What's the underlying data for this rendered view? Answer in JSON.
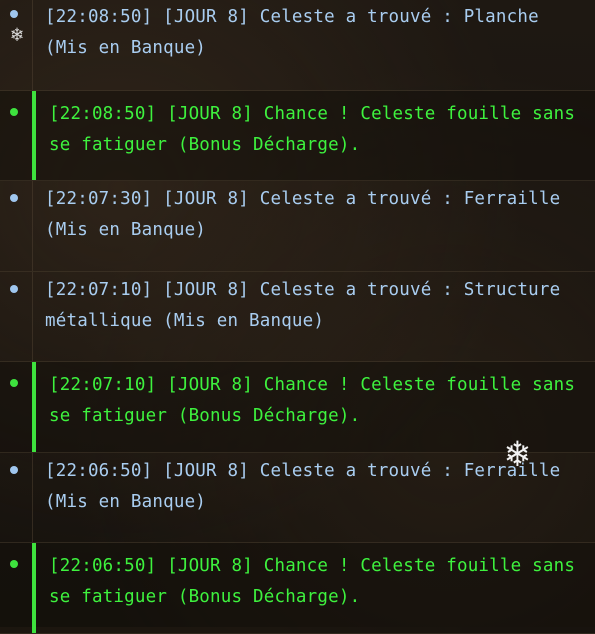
{
  "log": {
    "entries": [
      {
        "type": "info",
        "text": "[22:08:50] [JOUR 8] Celeste a trouvé : Planche\n(Mis en Banque)"
      },
      {
        "type": "success",
        "text": "[22:08:50] [JOUR 8] Chance ! Celeste fouille sans\nse fatiguer (Bonus Décharge)."
      },
      {
        "type": "info",
        "text": "[22:07:30] [JOUR 8] Celeste a trouvé : Ferraille\n(Mis en Banque)"
      },
      {
        "type": "info",
        "text": "[22:07:10] [JOUR 8] Celeste a trouvé : Structure\nmétallique (Mis en Banque)"
      },
      {
        "type": "success",
        "text": "[22:07:10] [JOUR 8] Chance ! Celeste fouille sans\nse fatiguer (Bonus Décharge)."
      },
      {
        "type": "info",
        "text": "[22:06:50] [JOUR 8] Celeste a trouvé : Ferraille\n(Mis en Banque)"
      },
      {
        "type": "success",
        "text": "[22:06:50] [JOUR 8] Chance ! Celeste fouille sans\nse fatiguer (Bonus Décharge)."
      }
    ]
  },
  "decorations": {
    "snowflake_glyph": "❄",
    "snowflake_icon": "snowflake-icon"
  },
  "colors": {
    "info_text": "#a9cdf0",
    "info_bullet": "#9fc6ee",
    "success_text": "#3ef23e",
    "success_bar": "#3ee23e",
    "background": "#1a1510"
  }
}
